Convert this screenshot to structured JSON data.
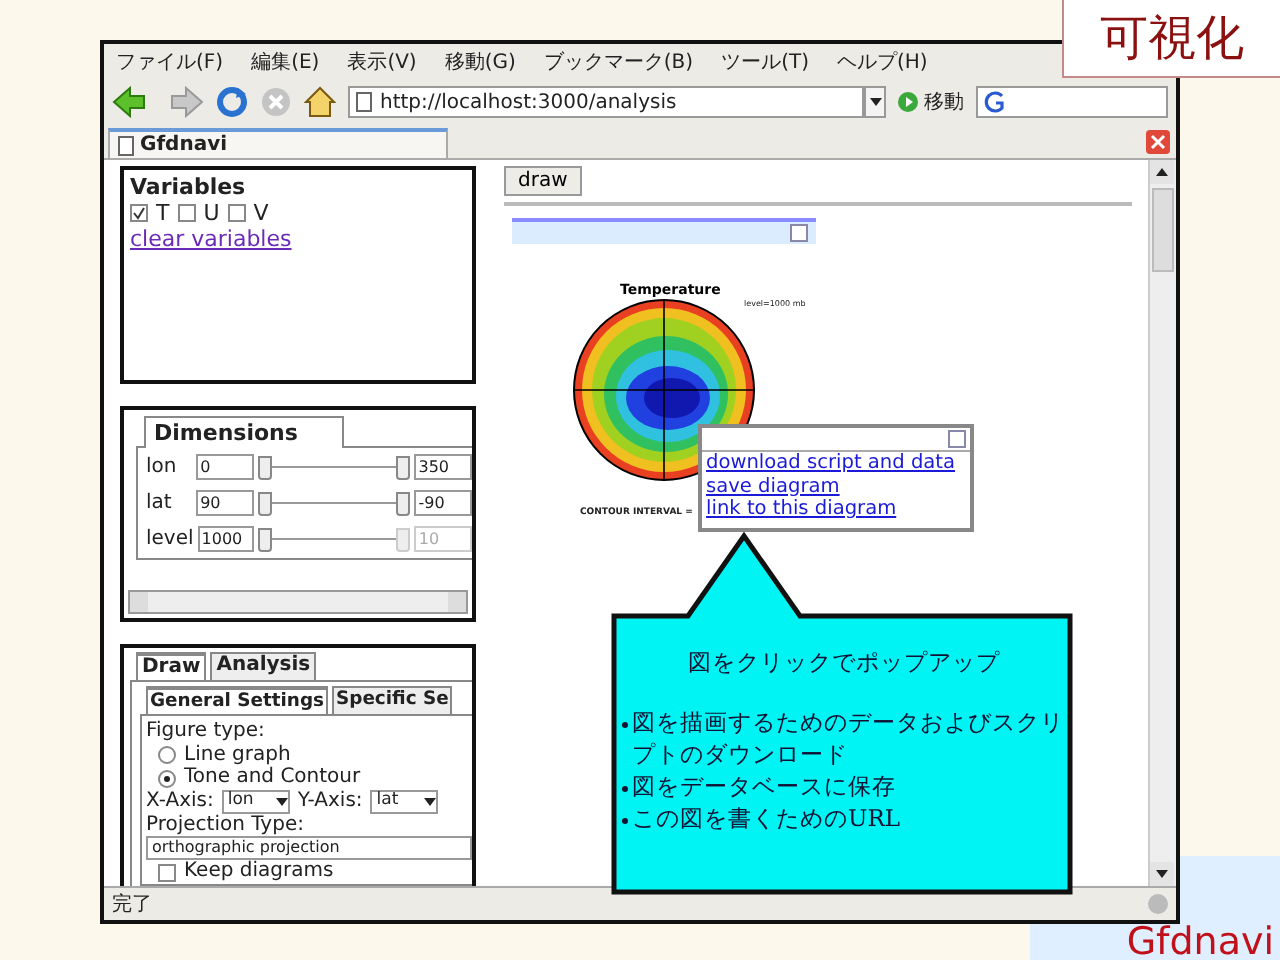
{
  "slide_label": "可視化",
  "browser": {
    "menu": [
      "ファイル(F)",
      "編集(E)",
      "表示(V)",
      "移動(G)",
      "ブックマーク(B)",
      "ツール(T)",
      "ヘルプ(H)"
    ],
    "url": "http://localhost:3000/analysis",
    "go_label": "移動",
    "tab": "Gfdnavi",
    "status": "完了"
  },
  "variables_panel": {
    "title": "Variables",
    "items": [
      {
        "label": "T",
        "checked": true
      },
      {
        "label": "U",
        "checked": false
      },
      {
        "label": "V",
        "checked": false
      }
    ],
    "clear_link": "clear variables"
  },
  "dimensions_panel": {
    "tab": "Dimensions",
    "rows": [
      {
        "name": "lon",
        "start": "0",
        "end": "350",
        "disabled": false
      },
      {
        "name": "lat",
        "start": "90",
        "end": "-90",
        "disabled": false
      },
      {
        "name": "level",
        "start": "1000",
        "end": "10",
        "disabled": true
      }
    ]
  },
  "draw_panel": {
    "tabs": [
      {
        "label": "Draw",
        "selected": true
      },
      {
        "label": "Analysis",
        "selected": false
      }
    ],
    "subtabs": [
      {
        "label": "General Settings",
        "selected": true
      },
      {
        "label": "Specific Se",
        "selected": false
      }
    ],
    "figure_type_label": "Figure type:",
    "figure_types": [
      {
        "label": "Line graph",
        "selected": false
      },
      {
        "label": "Tone and Contour",
        "selected": true
      }
    ],
    "x_axis_label": "X-Axis:",
    "x_axis": "lon",
    "y_axis_label": "Y-Axis:",
    "y_axis": "lat",
    "projection_label": "Projection Type:",
    "projection": "orthographic projection",
    "keep": {
      "label": "Keep diagrams",
      "checked": false
    }
  },
  "draw_button": "draw",
  "figure": {
    "title": "Temperature",
    "level_note": "level=1000 mb",
    "footer": "CONTOUR INTERVAL ="
  },
  "popup": {
    "links": [
      "download script and data",
      "save diagram",
      "link to this diagram"
    ]
  },
  "callout": {
    "title": "図をクリックでポップアップ",
    "bullets": [
      "図を描画するためのデータおよびスクリプトのダウンロード",
      "図をデータベースに保存",
      "この図を書くためのURL"
    ]
  },
  "logo": "Gfdnavi"
}
